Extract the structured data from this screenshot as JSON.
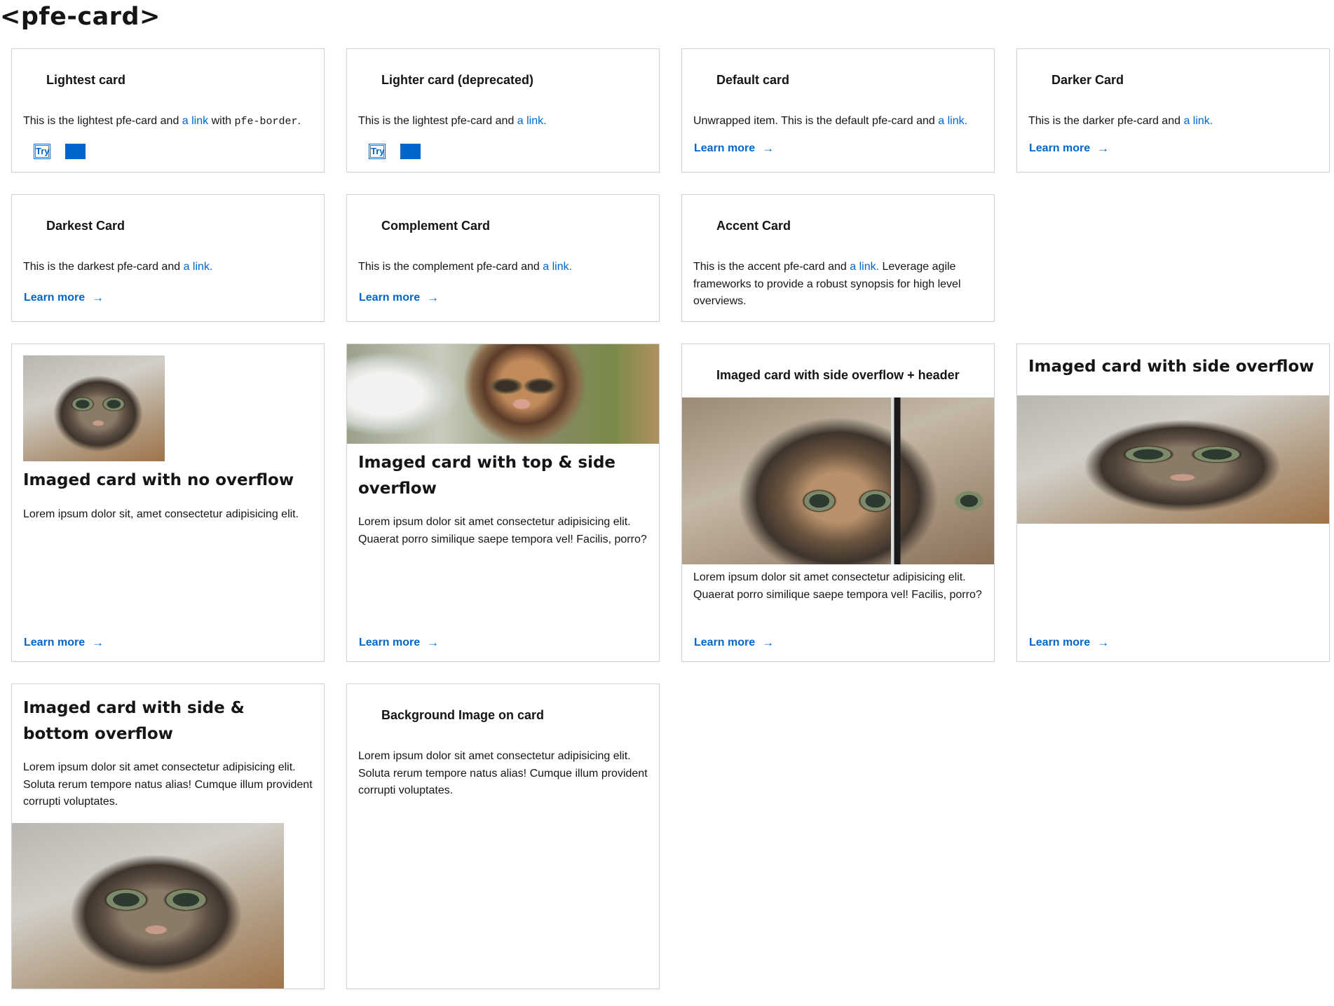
{
  "page": {
    "title": "<pfe-card>"
  },
  "cards": {
    "lightest": {
      "header": "Lightest card",
      "text_before": "This is the lightest pfe-card and ",
      "link": "a link",
      "text_mid": " with ",
      "code": "pfe-border",
      "text_after": ".",
      "try_label": "Try"
    },
    "lighter": {
      "header": "Lighter card (deprecated)",
      "text_before": "This is the lightest pfe-card and ",
      "link": "a link.",
      "try_label": "Try"
    },
    "default": {
      "header": "Default card",
      "text_before": "Unwrapped item. This is the default pfe-card and ",
      "link": "a link.",
      "cta": "Learn more"
    },
    "darker": {
      "header": "Darker Card",
      "text_before": "This is the darker pfe-card and ",
      "link": "a link.",
      "cta": "Learn more"
    },
    "darkest": {
      "header": "Darkest Card",
      "text_before": "This is the darkest pfe-card and ",
      "link": "a link.",
      "cta": "Learn more"
    },
    "complement": {
      "header": "Complement Card",
      "text_before": "This is the complement pfe-card and ",
      "link": "a link.",
      "cta": "Learn more"
    },
    "accent": {
      "header": "Accent Card",
      "text_before": "This is the accent pfe-card and ",
      "link": "a link.",
      "text_after": " Leverage agile frameworks to provide a robust synopsis for high level overviews."
    },
    "no_overflow": {
      "title": "Imaged card with no overflow",
      "body": "Lorem ipsum dolor sit, amet consectetur adipisicing elit.",
      "cta": "Learn more"
    },
    "top_side": {
      "title": "Imaged card with top & side overflow",
      "body": "Lorem ipsum dolor sit amet consectetur adipisicing elit. Quaerat porro similique saepe tempora vel! Facilis, porro?",
      "cta": "Learn more"
    },
    "side_header": {
      "header": "Imaged card with side overflow + header",
      "body": "Lorem ipsum dolor sit amet consectetur adipisicing elit. Quaerat porro similique saepe tempora vel! Facilis, porro?",
      "cta": "Learn more"
    },
    "side": {
      "title": "Imaged card with side overflow",
      "cta": "Learn more"
    },
    "side_bottom": {
      "title": "Imaged card with side & bottom overflow",
      "body": "Lorem ipsum dolor sit amet consectetur adipisicing elit. Soluta rerum tempore natus alias! Cumque illum provident corrupti voluptates."
    },
    "background": {
      "header": "Background Image on card",
      "body": "Lorem ipsum dolor sit amet consectetur adipisicing elit. Soluta rerum tempore natus alias! Cumque illum provident corrupti voluptates."
    }
  },
  "icons": {
    "cta_arrow": "arrow-right-icon"
  },
  "colors": {
    "link": "#0066cc",
    "border": "#d2d2d2",
    "text": "#151515"
  }
}
